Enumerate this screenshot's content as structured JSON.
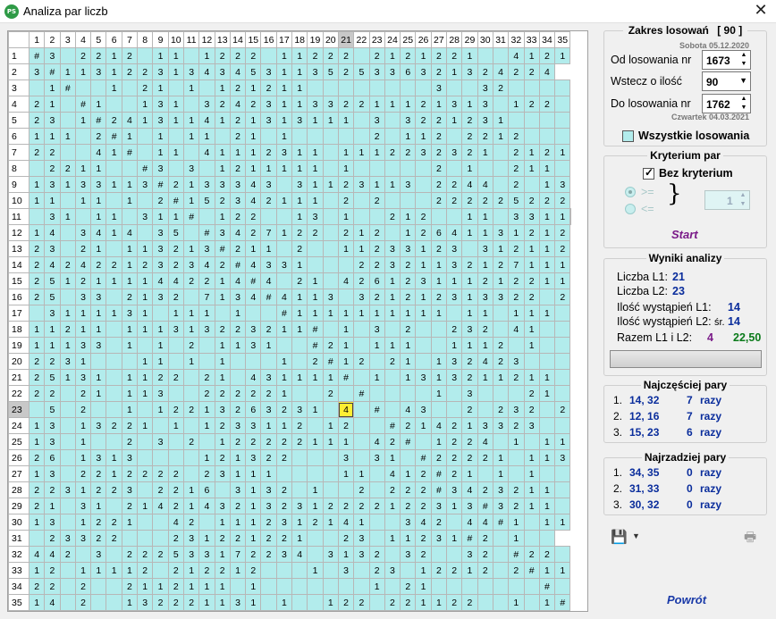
{
  "window": {
    "title": "Analiza par liczb",
    "icon": "app-ps-icon",
    "icon_text": "PS"
  },
  "columns": [
    "1",
    "2",
    "3",
    "4",
    "5",
    "6",
    "7",
    "8",
    "9",
    "10",
    "11",
    "12",
    "13",
    "14",
    "15",
    "16",
    "17",
    "18",
    "19",
    "20",
    "21",
    "22",
    "23",
    "24",
    "25",
    "26",
    "27",
    "28",
    "29",
    "30",
    "31",
    "32",
    "33",
    "34",
    "35"
  ],
  "highlight": {
    "column": "21",
    "row": "23"
  },
  "selected_cell": {
    "row": "23",
    "column": "21",
    "value": "4"
  },
  "rows": [
    [
      "1",
      "#",
      "3",
      "",
      "2",
      "2",
      "1",
      "2",
      "",
      "1",
      "1",
      "",
      "1",
      "2",
      "2",
      "2",
      "",
      "1",
      "1",
      "2",
      "2",
      "2",
      "",
      "2",
      "1",
      "2",
      "1",
      "2",
      "2",
      "1",
      "",
      "",
      "4",
      "1",
      "2",
      "1"
    ],
    [
      "2",
      "3",
      "#",
      "1",
      "1",
      "3",
      "1",
      "2",
      "2",
      "3",
      "1",
      "3",
      "4",
      "3",
      "4",
      "5",
      "3",
      "1",
      "1",
      "3",
      "5",
      "2",
      "5",
      "3",
      "3",
      "6",
      "3",
      "2",
      "1",
      "3",
      "2",
      "4",
      "2",
      "2",
      "4"
    ],
    [
      "3",
      "",
      "1",
      "#",
      "",
      "",
      "1",
      "",
      "2",
      "1",
      "",
      "1",
      "",
      "1",
      "2",
      "1",
      "2",
      "1",
      "1",
      "",
      "",
      "",
      "",
      "",
      "",
      "",
      "",
      "3",
      "",
      "",
      "3",
      "2",
      "",
      "",
      "",
      ""
    ],
    [
      "4",
      "2",
      "1",
      "",
      "#",
      "1",
      "",
      "",
      "1",
      "3",
      "1",
      "",
      "3",
      "2",
      "4",
      "2",
      "3",
      "1",
      "1",
      "3",
      "3",
      "2",
      "2",
      "1",
      "1",
      "1",
      "2",
      "1",
      "3",
      "1",
      "3",
      "",
      "1",
      "2",
      "2",
      ""
    ],
    [
      "5",
      "2",
      "3",
      "",
      "1",
      "#",
      "2",
      "4",
      "1",
      "3",
      "1",
      "1",
      "4",
      "1",
      "2",
      "1",
      "3",
      "1",
      "3",
      "1",
      "1",
      "1",
      "",
      "3",
      "",
      "3",
      "2",
      "2",
      "1",
      "2",
      "3",
      "1",
      "",
      "",
      "",
      ""
    ],
    [
      "6",
      "1",
      "1",
      "1",
      "",
      "2",
      "#",
      "1",
      "",
      "1",
      "",
      "1",
      "1",
      "",
      "2",
      "1",
      "",
      "1",
      "",
      "",
      "",
      "",
      "",
      "2",
      "",
      "1",
      "1",
      "2",
      "",
      "2",
      "2",
      "1",
      "2",
      "",
      "",
      ""
    ],
    [
      "7",
      "2",
      "2",
      "",
      "",
      "4",
      "1",
      "#",
      "",
      "1",
      "1",
      "",
      "4",
      "1",
      "1",
      "1",
      "2",
      "3",
      "1",
      "1",
      "",
      "1",
      "1",
      "1",
      "2",
      "2",
      "3",
      "2",
      "3",
      "2",
      "1",
      "",
      "2",
      "1",
      "2",
      "1"
    ],
    [
      "8",
      "",
      "2",
      "2",
      "1",
      "1",
      "",
      "",
      "#",
      "3",
      "",
      "3",
      "",
      "1",
      "2",
      "1",
      "1",
      "1",
      "1",
      "1",
      "",
      "1",
      "",
      "",
      "",
      "",
      "",
      "2",
      "",
      "1",
      "",
      "",
      "2",
      "1",
      "1",
      ""
    ],
    [
      "9",
      "1",
      "3",
      "1",
      "3",
      "3",
      "1",
      "1",
      "3",
      "#",
      "2",
      "1",
      "3",
      "3",
      "3",
      "4",
      "3",
      "",
      "3",
      "1",
      "1",
      "2",
      "3",
      "1",
      "1",
      "3",
      "",
      "2",
      "2",
      "4",
      "4",
      "",
      "2",
      "",
      "1",
      "3"
    ],
    [
      "10",
      "1",
      "1",
      "",
      "1",
      "1",
      "",
      "1",
      "",
      "2",
      "#",
      "1",
      "5",
      "2",
      "3",
      "4",
      "2",
      "1",
      "1",
      "1",
      "",
      "2",
      "",
      "2",
      "",
      "",
      "",
      "2",
      "2",
      "2",
      "2",
      "2",
      "5",
      "2",
      "2",
      "2"
    ],
    [
      "11",
      "",
      "3",
      "1",
      "",
      "1",
      "1",
      "",
      "3",
      "1",
      "1",
      "#",
      "",
      "1",
      "2",
      "2",
      "",
      "",
      "1",
      "3",
      "",
      "1",
      "",
      "",
      "2",
      "1",
      "2",
      "",
      "",
      "1",
      "1",
      "",
      "3",
      "3",
      "1",
      "1",
      ""
    ],
    [
      "12",
      "1",
      "4",
      "",
      "3",
      "4",
      "1",
      "4",
      "",
      "3",
      "5",
      "",
      "#",
      "3",
      "4",
      "2",
      "7",
      "1",
      "2",
      "2",
      "",
      "2",
      "1",
      "2",
      "",
      "1",
      "2",
      "6",
      "4",
      "1",
      "1",
      "3",
      "1",
      "2",
      "1",
      "2"
    ],
    [
      "13",
      "2",
      "3",
      "",
      "2",
      "1",
      "",
      "1",
      "1",
      "3",
      "2",
      "1",
      "3",
      "#",
      "2",
      "1",
      "1",
      "",
      "2",
      "",
      "",
      "1",
      "1",
      "2",
      "3",
      "3",
      "1",
      "2",
      "3",
      "",
      "3",
      "1",
      "2",
      "1",
      "1",
      "2"
    ],
    [
      "14",
      "2",
      "4",
      "2",
      "4",
      "2",
      "2",
      "1",
      "2",
      "3",
      "2",
      "3",
      "4",
      "2",
      "#",
      "4",
      "3",
      "3",
      "1",
      "",
      "",
      "",
      "2",
      "2",
      "3",
      "2",
      "1",
      "1",
      "3",
      "2",
      "1",
      "2",
      "7",
      "1",
      "1",
      "1"
    ],
    [
      "15",
      "2",
      "5",
      "1",
      "2",
      "1",
      "1",
      "1",
      "1",
      "4",
      "4",
      "2",
      "2",
      "1",
      "4",
      "#",
      "4",
      "",
      "2",
      "1",
      "",
      "4",
      "2",
      "6",
      "1",
      "2",
      "3",
      "1",
      "1",
      "1",
      "2",
      "1",
      "2",
      "2",
      "1",
      "1"
    ],
    [
      "16",
      "2",
      "5",
      "",
      "3",
      "3",
      "",
      "2",
      "1",
      "3",
      "2",
      "",
      "7",
      "1",
      "3",
      "4",
      "#",
      "4",
      "1",
      "1",
      "3",
      "",
      "3",
      "2",
      "1",
      "2",
      "1",
      "2",
      "3",
      "1",
      "3",
      "3",
      "2",
      "2",
      "",
      "2"
    ],
    [
      "17",
      "",
      "3",
      "1",
      "1",
      "1",
      "1",
      "3",
      "1",
      "",
      "1",
      "1",
      "1",
      "",
      "1",
      "",
      "",
      "#",
      "1",
      "1",
      "1",
      "1",
      "1",
      "1",
      "1",
      "1",
      "1",
      "1",
      "",
      "1",
      "1",
      "",
      "1",
      "1",
      "1",
      ""
    ],
    [
      "18",
      "1",
      "1",
      "2",
      "1",
      "1",
      "",
      "1",
      "1",
      "1",
      "3",
      "1",
      "3",
      "2",
      "2",
      "3",
      "2",
      "1",
      "1",
      "#",
      "",
      "1",
      "",
      "3",
      "",
      "2",
      "",
      "",
      "2",
      "3",
      "2",
      "",
      "4",
      "1",
      "",
      ""
    ],
    [
      "19",
      "1",
      "1",
      "1",
      "3",
      "3",
      "",
      "1",
      "",
      "1",
      "",
      "2",
      "",
      "1",
      "1",
      "3",
      "1",
      "",
      "",
      "#",
      "2",
      "1",
      "",
      "1",
      "1",
      "1",
      "",
      "",
      "1",
      "1",
      "1",
      "2",
      "",
      "1",
      "",
      ""
    ],
    [
      "20",
      "2",
      "2",
      "3",
      "1",
      "",
      "",
      "",
      "1",
      "1",
      "",
      "1",
      "",
      "1",
      "",
      "",
      "",
      "1",
      "",
      "2",
      "#",
      "1",
      "2",
      "",
      "2",
      "1",
      "",
      "1",
      "3",
      "2",
      "4",
      "2",
      "3",
      "",
      "",
      ""
    ],
    [
      "21",
      "2",
      "5",
      "1",
      "3",
      "1",
      "",
      "1",
      "1",
      "2",
      "2",
      "",
      "2",
      "1",
      "",
      "4",
      "3",
      "1",
      "1",
      "1",
      "1",
      "#",
      "",
      "1",
      "",
      "1",
      "3",
      "1",
      "3",
      "2",
      "1",
      "1",
      "2",
      "1",
      "1",
      ""
    ],
    [
      "22",
      "2",
      "2",
      "",
      "2",
      "1",
      "",
      "1",
      "1",
      "3",
      "",
      "",
      "2",
      "2",
      "2",
      "2",
      "2",
      "1",
      "",
      "",
      "2",
      "",
      "#",
      "",
      "",
      "",
      "",
      "1",
      "",
      "3",
      "",
      "",
      "",
      "2",
      "1",
      ""
    ],
    [
      "23",
      "",
      "5",
      "",
      "2",
      "",
      "",
      "1",
      "",
      "1",
      "2",
      "2",
      "1",
      "3",
      "2",
      "6",
      "3",
      "2",
      "3",
      "1",
      "",
      "4",
      "",
      "#",
      "",
      "4",
      "3",
      "",
      "",
      "2",
      "",
      "2",
      "3",
      "2",
      "",
      "2"
    ],
    [
      "24",
      "1",
      "3",
      "",
      "1",
      "3",
      "2",
      "2",
      "1",
      "",
      "1",
      "",
      "1",
      "2",
      "3",
      "3",
      "1",
      "1",
      "2",
      "",
      "1",
      "2",
      "",
      "",
      "#",
      "2",
      "1",
      "4",
      "2",
      "1",
      "3",
      "3",
      "2",
      "3",
      "",
      ""
    ],
    [
      "25",
      "1",
      "3",
      "",
      "1",
      "",
      "",
      "2",
      "",
      "3",
      "",
      "2",
      "",
      "1",
      "2",
      "2",
      "2",
      "2",
      "2",
      "1",
      "1",
      "1",
      "",
      "4",
      "2",
      "#",
      "",
      "1",
      "2",
      "2",
      "4",
      "",
      "1",
      "",
      "1",
      "1"
    ],
    [
      "26",
      "2",
      "6",
      "",
      "1",
      "3",
      "1",
      "3",
      "",
      "",
      "",
      "",
      "1",
      "2",
      "1",
      "3",
      "2",
      "2",
      "",
      "",
      "",
      "3",
      "",
      "3",
      "1",
      "",
      "#",
      "2",
      "2",
      "2",
      "2",
      "1",
      "",
      "1",
      "1",
      "3"
    ],
    [
      "27",
      "1",
      "3",
      "",
      "2",
      "2",
      "1",
      "2",
      "2",
      "2",
      "2",
      "",
      "2",
      "3",
      "1",
      "1",
      "1",
      "",
      "",
      "",
      "",
      "1",
      "1",
      "",
      "4",
      "1",
      "2",
      "#",
      "2",
      "1",
      "",
      "1",
      "",
      "1",
      "",
      ""
    ],
    [
      "28",
      "2",
      "2",
      "3",
      "1",
      "2",
      "2",
      "3",
      "",
      "2",
      "2",
      "1",
      "6",
      "",
      "3",
      "1",
      "3",
      "2",
      "",
      "1",
      "",
      "",
      "2",
      "",
      "2",
      "2",
      "2",
      "#",
      "3",
      "4",
      "2",
      "3",
      "2",
      "1",
      "1",
      ""
    ],
    [
      "29",
      "2",
      "1",
      "",
      "3",
      "1",
      "",
      "2",
      "1",
      "4",
      "2",
      "1",
      "4",
      "3",
      "2",
      "1",
      "3",
      "2",
      "3",
      "1",
      "2",
      "2",
      "2",
      "2",
      "1",
      "2",
      "2",
      "3",
      "1",
      "3",
      "#",
      "3",
      "2",
      "1",
      "1",
      ""
    ],
    [
      "30",
      "1",
      "3",
      "",
      "1",
      "2",
      "2",
      "1",
      "",
      "",
      "4",
      "2",
      "",
      "1",
      "1",
      "1",
      "2",
      "3",
      "1",
      "2",
      "1",
      "4",
      "1",
      "",
      "",
      "3",
      "4",
      "2",
      "",
      "4",
      "4",
      "#",
      "1",
      "",
      "1",
      "1"
    ],
    [
      "31",
      "",
      "2",
      "3",
      "3",
      "2",
      "2",
      "",
      "",
      "",
      "2",
      "3",
      "1",
      "2",
      "2",
      "1",
      "2",
      "2",
      "1",
      "",
      "",
      "2",
      "3",
      "",
      "1",
      "1",
      "2",
      "3",
      "1",
      "#",
      "2",
      "",
      "1",
      "",
      ""
    ],
    [
      "32",
      "4",
      "4",
      "2",
      "",
      "3",
      "",
      "2",
      "2",
      "2",
      "5",
      "3",
      "3",
      "1",
      "7",
      "2",
      "2",
      "3",
      "4",
      "",
      "3",
      "1",
      "3",
      "2",
      "",
      "3",
      "2",
      "",
      "",
      "3",
      "2",
      "",
      "#",
      "2",
      "2",
      ""
    ],
    [
      "33",
      "1",
      "2",
      "",
      "1",
      "1",
      "1",
      "1",
      "2",
      "",
      "2",
      "1",
      "2",
      "2",
      "1",
      "2",
      "",
      "",
      "",
      "1",
      "",
      "3",
      "",
      "2",
      "3",
      "",
      "1",
      "2",
      "2",
      "1",
      "2",
      "",
      "2",
      "#",
      "1",
      "1"
    ],
    [
      "34",
      "2",
      "2",
      "",
      "2",
      "",
      "",
      "2",
      "1",
      "1",
      "2",
      "1",
      "1",
      "1",
      "",
      "1",
      "",
      "",
      "",
      "",
      "",
      "",
      "",
      "1",
      "",
      "2",
      "1",
      "",
      "",
      "",
      "",
      "",
      "",
      "",
      "#",
      ""
    ],
    [
      "35",
      "1",
      "4",
      "",
      "2",
      "",
      "",
      "1",
      "3",
      "2",
      "2",
      "2",
      "1",
      "1",
      "3",
      "1",
      "",
      "1",
      "",
      "",
      "1",
      "2",
      "2",
      "",
      "2",
      "2",
      "1",
      "1",
      "2",
      "2",
      "",
      "",
      "1",
      "",
      "1",
      "#"
    ]
  ],
  "zakres": {
    "title": "Zakres losowań",
    "count": "[ 90 ]",
    "from_date": "Sobota 05.12.2020",
    "od_label": "Od losowania nr",
    "od_value": "1673",
    "wstecz_label": "Wstecz o ilość",
    "wstecz_value": "90",
    "do_label": "Do losowania nr",
    "do_value": "1762",
    "to_date": "Czwartek 04.03.2021",
    "all_label": "Wszystkie losowania"
  },
  "kryterium": {
    "title": "Kryterium par",
    "bez_label": "Bez kryterium",
    "ge": ">=",
    "le": "<=",
    "spin_value": "1",
    "start": "Start"
  },
  "wyniki": {
    "title": "Wyniki analizy",
    "l1_label": "Liczba L1:",
    "l1_value": "21",
    "l2_label": "Liczba L2:",
    "l2_value": "23",
    "il1_label": "Ilość wystąpień L1:",
    "il1_value": "14",
    "il2_label": "Ilość wystąpień L2:",
    "il2_value": "14",
    "sr_label": "śr.",
    "razem_label": "Razem L1 i L2:",
    "razem_value": "4",
    "avg_value": "22,50"
  },
  "najczesciej": {
    "title": "Najczęściej pary",
    "items": [
      {
        "idx": "1.",
        "pair": "14, 32",
        "count": "7",
        "unit": "razy"
      },
      {
        "idx": "2.",
        "pair": "12, 16",
        "count": "7",
        "unit": "razy"
      },
      {
        "idx": "3.",
        "pair": "15, 23",
        "count": "6",
        "unit": "razy"
      }
    ]
  },
  "najrzadziej": {
    "title": "Najrzadziej pary",
    "items": [
      {
        "idx": "1.",
        "pair": "34, 35",
        "count": "0",
        "unit": "razy"
      },
      {
        "idx": "2.",
        "pair": "31, 33",
        "count": "0",
        "unit": "razy"
      },
      {
        "idx": "3.",
        "pair": "30, 32",
        "count": "0",
        "unit": "razy"
      }
    ]
  },
  "footer": {
    "back": "Powrót"
  },
  "colors": {
    "cell": "#b2ecec",
    "selected": "#ffee33",
    "accent_blue": "#0a2d9c",
    "accent_purple": "#7a1a88",
    "accent_green": "#0a7a1a"
  }
}
